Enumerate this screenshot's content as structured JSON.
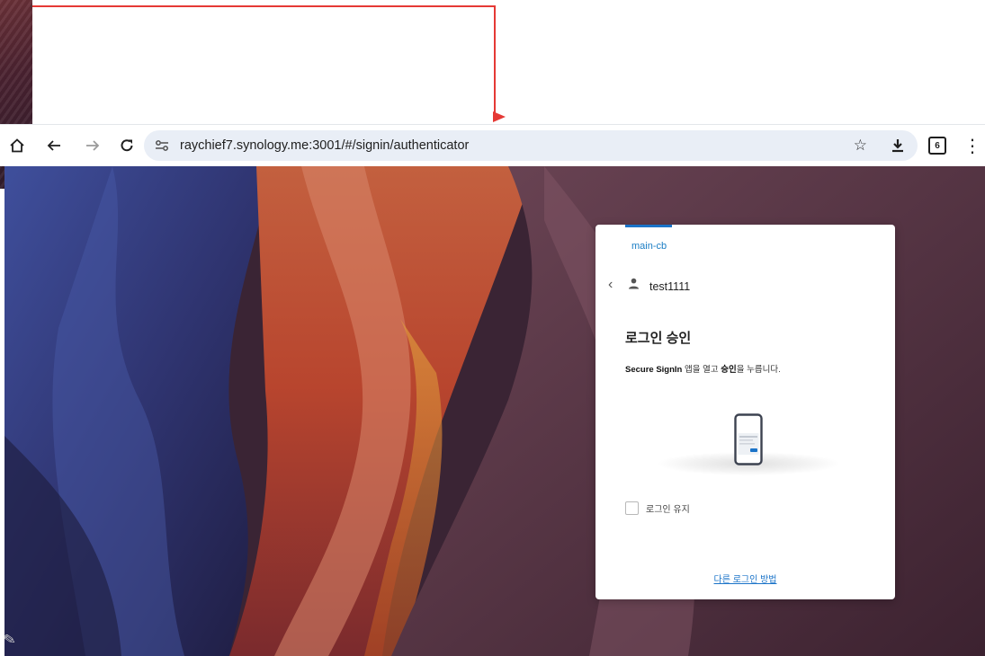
{
  "browser": {
    "url": "raychief7.synology.me:3001/#/signin/authenticator",
    "tab_count": "6",
    "icons": [
      "home-icon",
      "back-icon",
      "forward-icon",
      "reload-icon",
      "site-settings-icon",
      "star-icon",
      "download-icon",
      "tab-count-icon",
      "menu-icon"
    ]
  },
  "login": {
    "host_name": "main-cb",
    "username": "test1111",
    "title": "로그인 승인",
    "desc_app": "Secure SignIn",
    "desc_mid": " 앱을 열고 ",
    "desc_bold": "승인",
    "desc_end": "을 누릅니다.",
    "remember_label": "로그인 유지",
    "other_method_link": "다른 로그인 방법"
  },
  "colors": {
    "accent": "#1a73c8",
    "annotation": "#e53935",
    "omnibox_bg": "#e9eef6"
  }
}
